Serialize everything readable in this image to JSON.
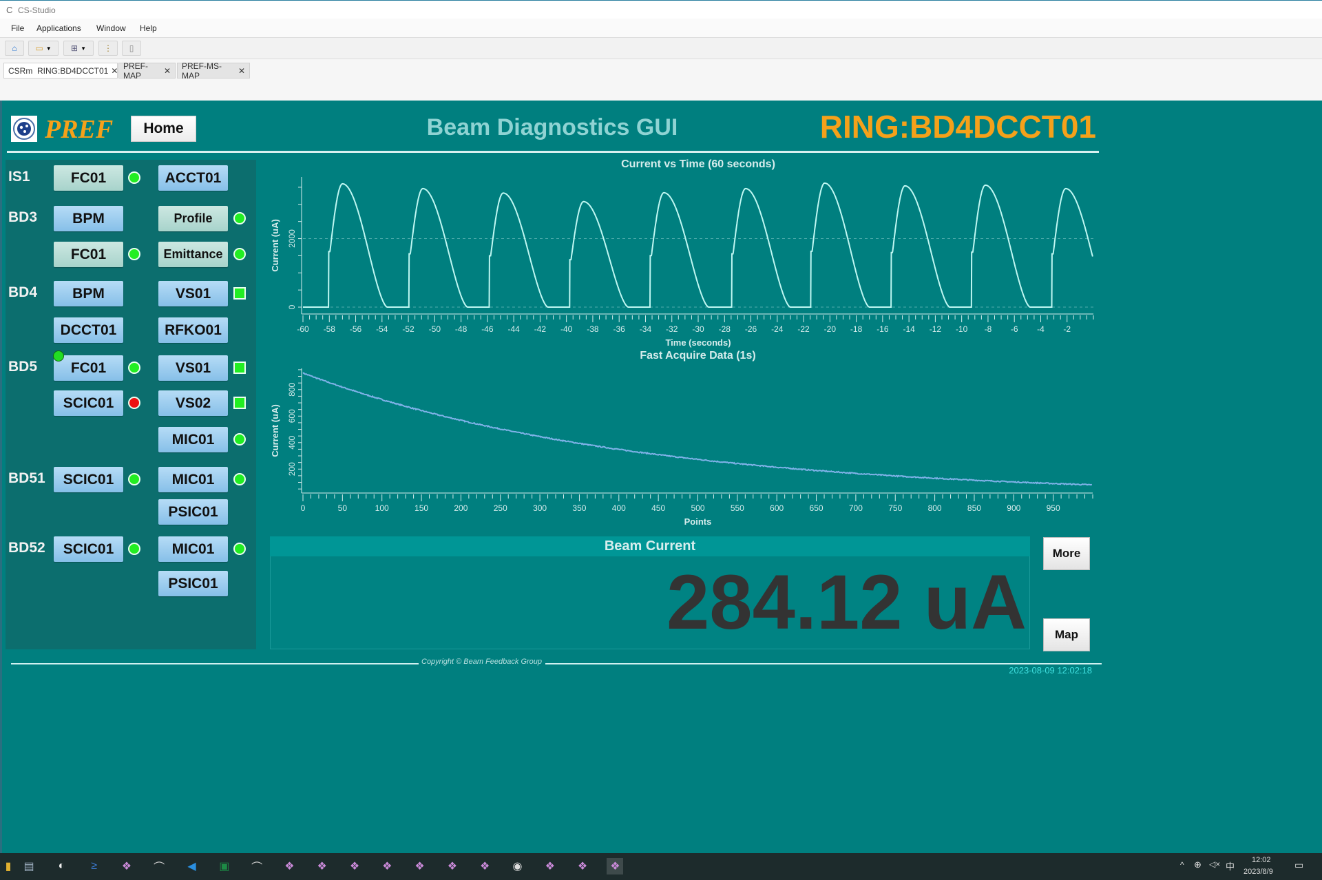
{
  "window": {
    "title": "CS-Studio"
  },
  "menu": [
    "File",
    "Applications",
    "Window",
    "Help"
  ],
  "toolbar": [
    {
      "icon": "home-icon"
    },
    {
      "icon": "open-folder-icon",
      "dropdown": true
    },
    {
      "icon": "layout-icon",
      "dropdown": true
    },
    {
      "icon": "tree-icon"
    },
    {
      "icon": "new-file-icon"
    }
  ],
  "tabs": [
    {
      "label": "CSRm  RING:BD4DCCT01",
      "active": true
    },
    {
      "label": "PREF-MAP",
      "active": false
    },
    {
      "label": "PREF-MS-MAP",
      "active": false
    }
  ],
  "header": {
    "brand": "PREF",
    "home_label": "Home",
    "title": "Beam Diagnostics GUI",
    "device": "RING:BD4DCCT01"
  },
  "colors": {
    "background": "#007f7f",
    "accent": "#f5a11a",
    "ok": "#22ee22",
    "alarm": "#ee1111"
  },
  "devices": [
    {
      "label": "IS1",
      "c1": {
        "text": "FC01",
        "style": "green",
        "ind": "circle-ok"
      },
      "c2": {
        "text": "ACCT01",
        "style": "blue",
        "ind": ""
      }
    },
    {
      "label": "BD3",
      "c1": {
        "text": "BPM",
        "style": "blue",
        "ind": ""
      },
      "c2": {
        "text": "Profile",
        "style": "green",
        "ind": "circle-ok",
        "small": true
      }
    },
    {
      "label": "",
      "c1": {
        "text": "FC01",
        "style": "green",
        "ind": "circle-ok"
      },
      "c2": {
        "text": "Emittance",
        "style": "green",
        "ind": "circle-ok",
        "small": true
      }
    },
    {
      "label": "BD4",
      "c1": {
        "text": "BPM",
        "style": "blue",
        "ind": ""
      },
      "c2": {
        "text": "VS01",
        "style": "blue",
        "ind": "square-ok"
      }
    },
    {
      "label": "",
      "c1": {
        "text": "DCCT01",
        "style": "blue",
        "ind": ""
      },
      "c2": {
        "text": "RFKO01",
        "style": "blue",
        "ind": ""
      }
    },
    {
      "label": "BD5",
      "c1": {
        "text": "FC01",
        "style": "blue",
        "ind": "circle-ok",
        "badge": true
      },
      "c2": {
        "text": "VS01",
        "style": "blue",
        "ind": "square-ok"
      }
    },
    {
      "label": "",
      "c1": {
        "text": "SCIC01",
        "style": "blue",
        "ind": "circle-alarm"
      },
      "c2": {
        "text": "VS02",
        "style": "blue",
        "ind": "square-ok"
      }
    },
    {
      "label": "",
      "c1": null,
      "c2": {
        "text": "MIC01",
        "style": "blue",
        "ind": "circle-ok"
      }
    },
    {
      "label": "BD51",
      "c1": {
        "text": "SCIC01",
        "style": "blue",
        "ind": "circle-ok"
      },
      "c2": {
        "text": "MIC01",
        "style": "blue",
        "ind": "circle-ok"
      }
    },
    {
      "label": "",
      "c1": null,
      "c2": {
        "text": "PSIC01",
        "style": "blue",
        "ind": ""
      }
    },
    {
      "label": "BD52",
      "c1": {
        "text": "SCIC01",
        "style": "blue",
        "ind": "circle-ok"
      },
      "c2": {
        "text": "MIC01",
        "style": "blue",
        "ind": "circle-ok"
      }
    },
    {
      "label": "",
      "c1": null,
      "c2": {
        "text": "PSIC01",
        "style": "blue",
        "ind": ""
      }
    }
  ],
  "chart_data": [
    {
      "type": "line",
      "title": "Current vs Time (60 seconds)",
      "xlabel": "Time (seconds)",
      "ylabel": "Current (uA)",
      "xlim": [
        -60,
        0
      ],
      "ylim": [
        -100,
        3800
      ],
      "xticks": [
        -60,
        -58,
        -56,
        -54,
        -52,
        -50,
        -48,
        -46,
        -44,
        -42,
        -40,
        -38,
        -36,
        -34,
        -32,
        -30,
        -28,
        -26,
        -24,
        -22,
        -20,
        -18,
        -16,
        -14,
        -12,
        -10,
        -8,
        -6,
        -4,
        -2
      ],
      "yticks": [
        0,
        2000
      ],
      "grid": "dashed at y ticks",
      "line_color": "#bff7f2",
      "pulses": [
        {
          "start": -58.1,
          "peak": 3600
        },
        {
          "start": -52.0,
          "peak": 3460
        },
        {
          "start": -45.9,
          "peak": 3330
        },
        {
          "start": -39.8,
          "peak": 3080
        },
        {
          "start": -33.7,
          "peak": 3340
        },
        {
          "start": -27.5,
          "peak": 3460
        },
        {
          "start": -21.5,
          "peak": 3620
        },
        {
          "start": -15.4,
          "peak": 3540
        },
        {
          "start": -9.3,
          "peak": 3560
        },
        {
          "start": -3.2,
          "peak": 3460
        }
      ]
    },
    {
      "type": "line",
      "title": "Fast Acquire Data (1s)",
      "xlabel": "Points",
      "ylabel": "Current (uA)",
      "xlim": [
        0,
        1000
      ],
      "ylim": [
        30,
        960
      ],
      "xticks": [
        0,
        50,
        100,
        150,
        200,
        250,
        300,
        350,
        400,
        450,
        500,
        550,
        600,
        650,
        700,
        750,
        800,
        850,
        900,
        950
      ],
      "yticks": [
        200,
        400,
        600,
        800
      ],
      "line_color": "#7fb2e8",
      "series": {
        "x_start": 0,
        "x_end": 999,
        "y_start": 925,
        "y_end": 81,
        "shape": "exponential decay"
      }
    }
  ],
  "beam": {
    "title": "Beam Current",
    "value": "284.12 uA",
    "more_label": "More",
    "map_label": "Map"
  },
  "footer": {
    "copyright": "Copyright © Beam Feedback Group",
    "timestamp": "2023-08-09 12:02:18"
  },
  "taskbar": {
    "time": "12:02",
    "date": "2023/8/9",
    "ime": "中"
  }
}
